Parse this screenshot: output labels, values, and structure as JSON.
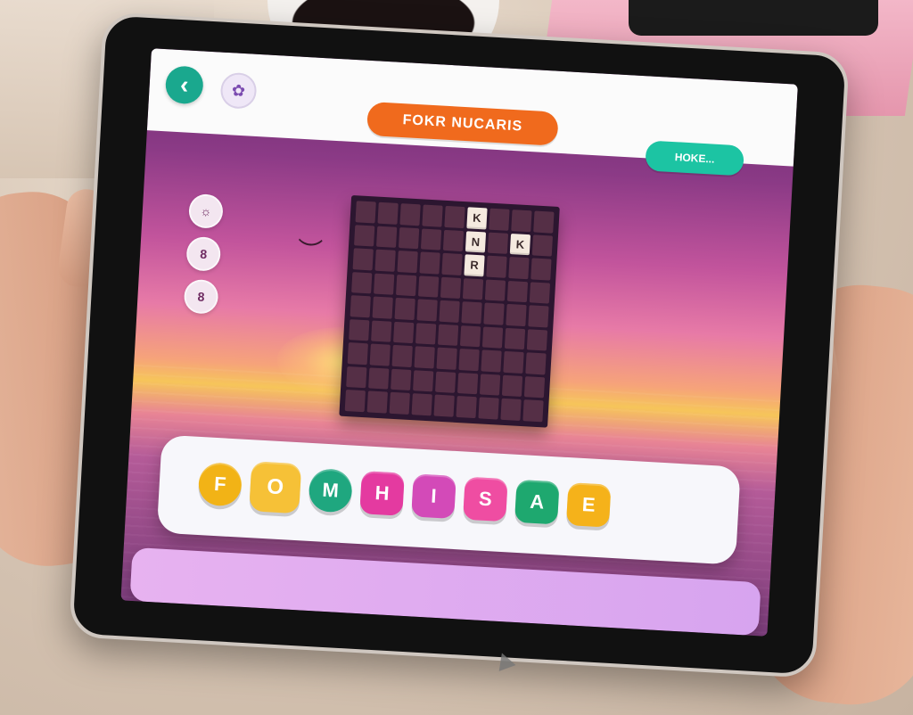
{
  "app": {
    "title": "FOKR NUCARIS",
    "title_small": "",
    "hint_label": "HOKE..."
  },
  "buttons": {
    "back_label": "‹",
    "settings_label": "✿"
  },
  "side_icons": [
    {
      "label": "☼"
    },
    {
      "label": "8"
    },
    {
      "label": "8"
    }
  ],
  "board": {
    "rows": 9,
    "cols": 9,
    "cells": [
      "",
      "",
      "",
      "",
      "",
      "K",
      "",
      "",
      "",
      "",
      "",
      "",
      "",
      "",
      "N",
      "",
      "K",
      "",
      "",
      "",
      "",
      "",
      "",
      "R",
      "",
      "",
      "",
      "",
      "",
      "",
      "",
      "",
      "",
      "",
      "",
      "",
      "",
      "",
      "",
      "",
      "",
      "",
      "",
      "",
      "",
      "",
      "",
      "",
      "",
      "",
      "",
      "",
      "",
      "",
      "",
      "",
      "",
      "",
      "",
      "",
      "",
      "",
      "",
      "",
      "",
      "",
      "",
      "",
      "",
      "",
      "",
      "",
      "",
      "",
      "",
      "",
      "",
      "",
      "",
      "",
      ""
    ]
  },
  "letter_tray": {
    "tiles": [
      {
        "letter": "F",
        "color": "#f2b316",
        "shape": "round"
      },
      {
        "letter": "O",
        "color": "#f6c137",
        "shape": "big"
      },
      {
        "letter": "M",
        "color": "#1fa77f",
        "shape": "round"
      },
      {
        "letter": "H",
        "color": "#e43aa0",
        "shape": ""
      },
      {
        "letter": "I",
        "color": "#d34ab8",
        "shape": ""
      },
      {
        "letter": "S",
        "color": "#ef4da2",
        "shape": ""
      },
      {
        "letter": "A",
        "color": "#1ea86f",
        "shape": ""
      },
      {
        "letter": "E",
        "color": "#f5b21a",
        "shape": ""
      }
    ]
  },
  "bottom_bar": {
    "label": ""
  }
}
